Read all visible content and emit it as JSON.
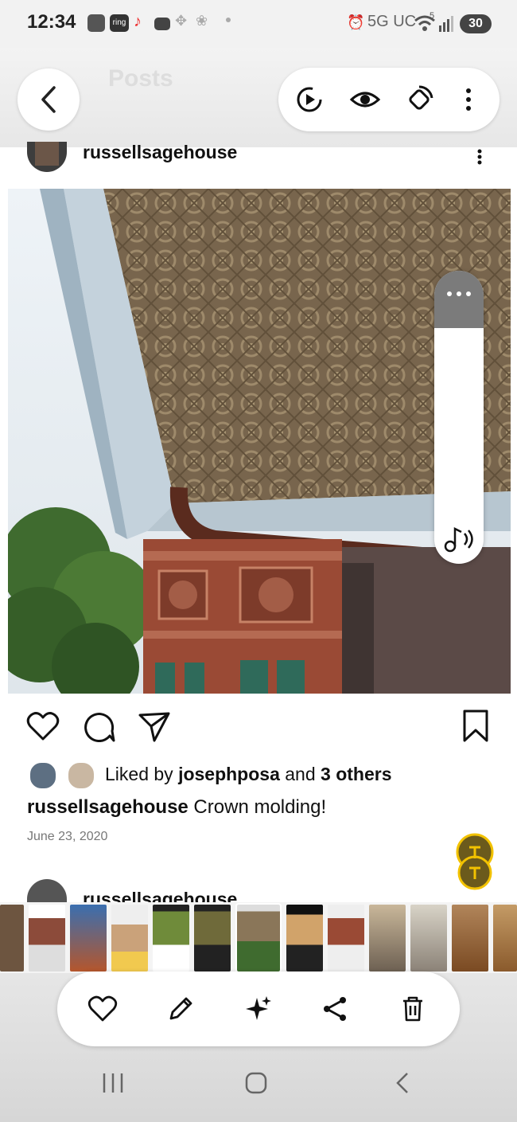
{
  "status_bar": {
    "time": "12:34",
    "network": "5G UC",
    "signal_superscript": "5",
    "battery": "30",
    "notification_icons": [
      "cast-icon",
      "ring-icon",
      "tiktok-icon",
      "mail-icon",
      "dots-icon",
      "fan-icon"
    ],
    "ring_label": "ring"
  },
  "viewer": {
    "faded_title": "Posts",
    "top_actions": [
      "play-motion-icon",
      "eye-icon",
      "rotate-icon",
      "more-vertical-icon"
    ]
  },
  "post": {
    "username": "russellsagehouse",
    "liked_prefix": "Liked by ",
    "liked_user": "josephposa",
    "liked_and": " and ",
    "liked_others": "3 others",
    "caption_user": "russellsagehouse",
    "caption_text": " Crown molding!",
    "date": "June 23, 2020",
    "next_username": "russellsagehouse"
  },
  "bottom_actions": [
    "heart-icon",
    "edit-icon",
    "sparkle-icon",
    "share-icon",
    "delete-icon"
  ],
  "nav_bar": [
    "recent-apps-icon",
    "home-icon",
    "back-icon"
  ],
  "colors": {
    "accent_yellow": "#f2c200",
    "pill_bg": "#ffffff",
    "bar_bg": "#e6e6e6"
  }
}
